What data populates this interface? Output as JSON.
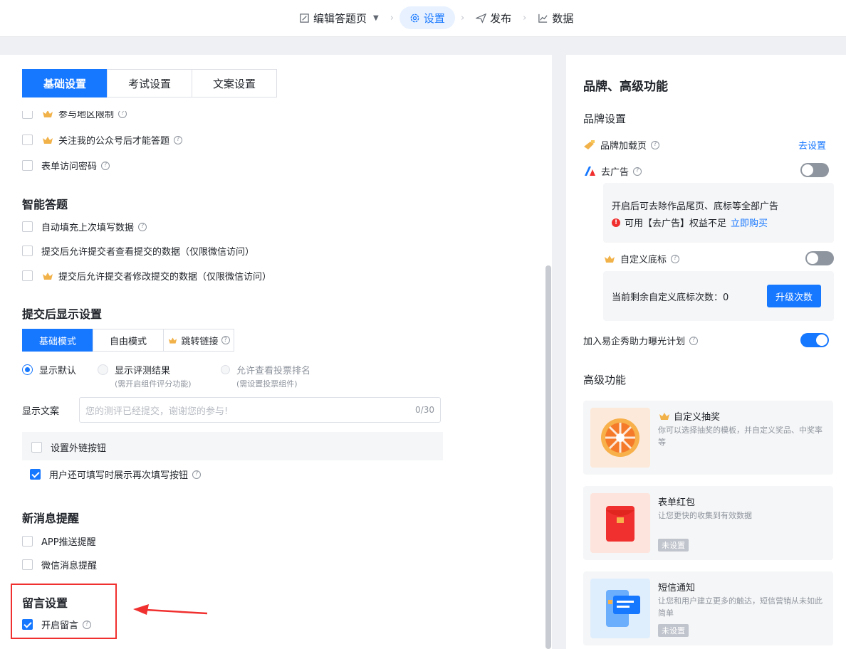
{
  "nav": {
    "steps": [
      {
        "label": "编辑答题页",
        "icon": "edit-icon"
      },
      {
        "label": "设置",
        "icon": "gear-icon"
      },
      {
        "label": "发布",
        "icon": "send-icon"
      },
      {
        "label": "数据",
        "icon": "chart-icon"
      }
    ]
  },
  "tabs": [
    "基础设置",
    "考试设置",
    "文案设置"
  ],
  "access": {
    "items": [
      "参与地区限制",
      "关注我的公众号后才能答题",
      "表单访问密码"
    ]
  },
  "smart": {
    "title": "智能答题",
    "items": [
      "自动填充上次填写数据",
      "提交后允许提交者查看提交的数据（仅限微信访问）",
      "提交后允许提交者修改提交的数据（仅限微信访问）"
    ]
  },
  "after_submit": {
    "title": "提交后显示设置",
    "modes": [
      "基础模式",
      "自由模式",
      "跳转链接"
    ],
    "radios": [
      {
        "label": "显示默认",
        "sub": ""
      },
      {
        "label": "显示评测结果",
        "sub": "(需开启组件评分功能)"
      },
      {
        "label": "允许查看投票排名",
        "sub": "(需设置投票组件)"
      }
    ],
    "text_label": "显示文案",
    "text_placeholder": "您的测评已经提交，谢谢您的参与!",
    "text_count": "0/30",
    "external_link": "设置外链按钮",
    "refill": "用户还可填写时展示再次填写按钮"
  },
  "notify": {
    "title": "新消息提醒",
    "items": [
      "APP推送提醒",
      "微信消息提醒"
    ]
  },
  "comment": {
    "title": "留言设置",
    "item": "开启留言"
  },
  "right": {
    "title": "品牌、高级功能",
    "brand_title": "品牌设置",
    "brand_loading": "品牌加载页",
    "go_setting": "去设置",
    "remove_ads": "去广告",
    "ads_desc": "开启后可去除作品尾页、底标等全部广告",
    "ads_warning": "可用【去广告】权益不足",
    "buy_now": "立即购买",
    "custom_footer": "自定义底标",
    "footer_remaining": "当前剩余自定义底标次数：0",
    "upgrade": "升级次数",
    "exposure_plan": "加入易企秀助力曝光计划",
    "advanced_title": "高级功能",
    "cards": [
      {
        "title": "自定义抽奖",
        "desc": "你可以选择抽奖的模板，并自定义奖品、中奖率等",
        "badge": ""
      },
      {
        "title": "表单红包",
        "desc": "让您更快的收集到有效数据",
        "badge": "未设置"
      },
      {
        "title": "短信通知",
        "desc": "让您和用户建立更多的触达，短信营销从未如此简单",
        "badge": "未设置"
      }
    ]
  },
  "colors": {
    "accent": "#1677ff",
    "highlight": "#f0302f",
    "warning": "#f0302f"
  }
}
